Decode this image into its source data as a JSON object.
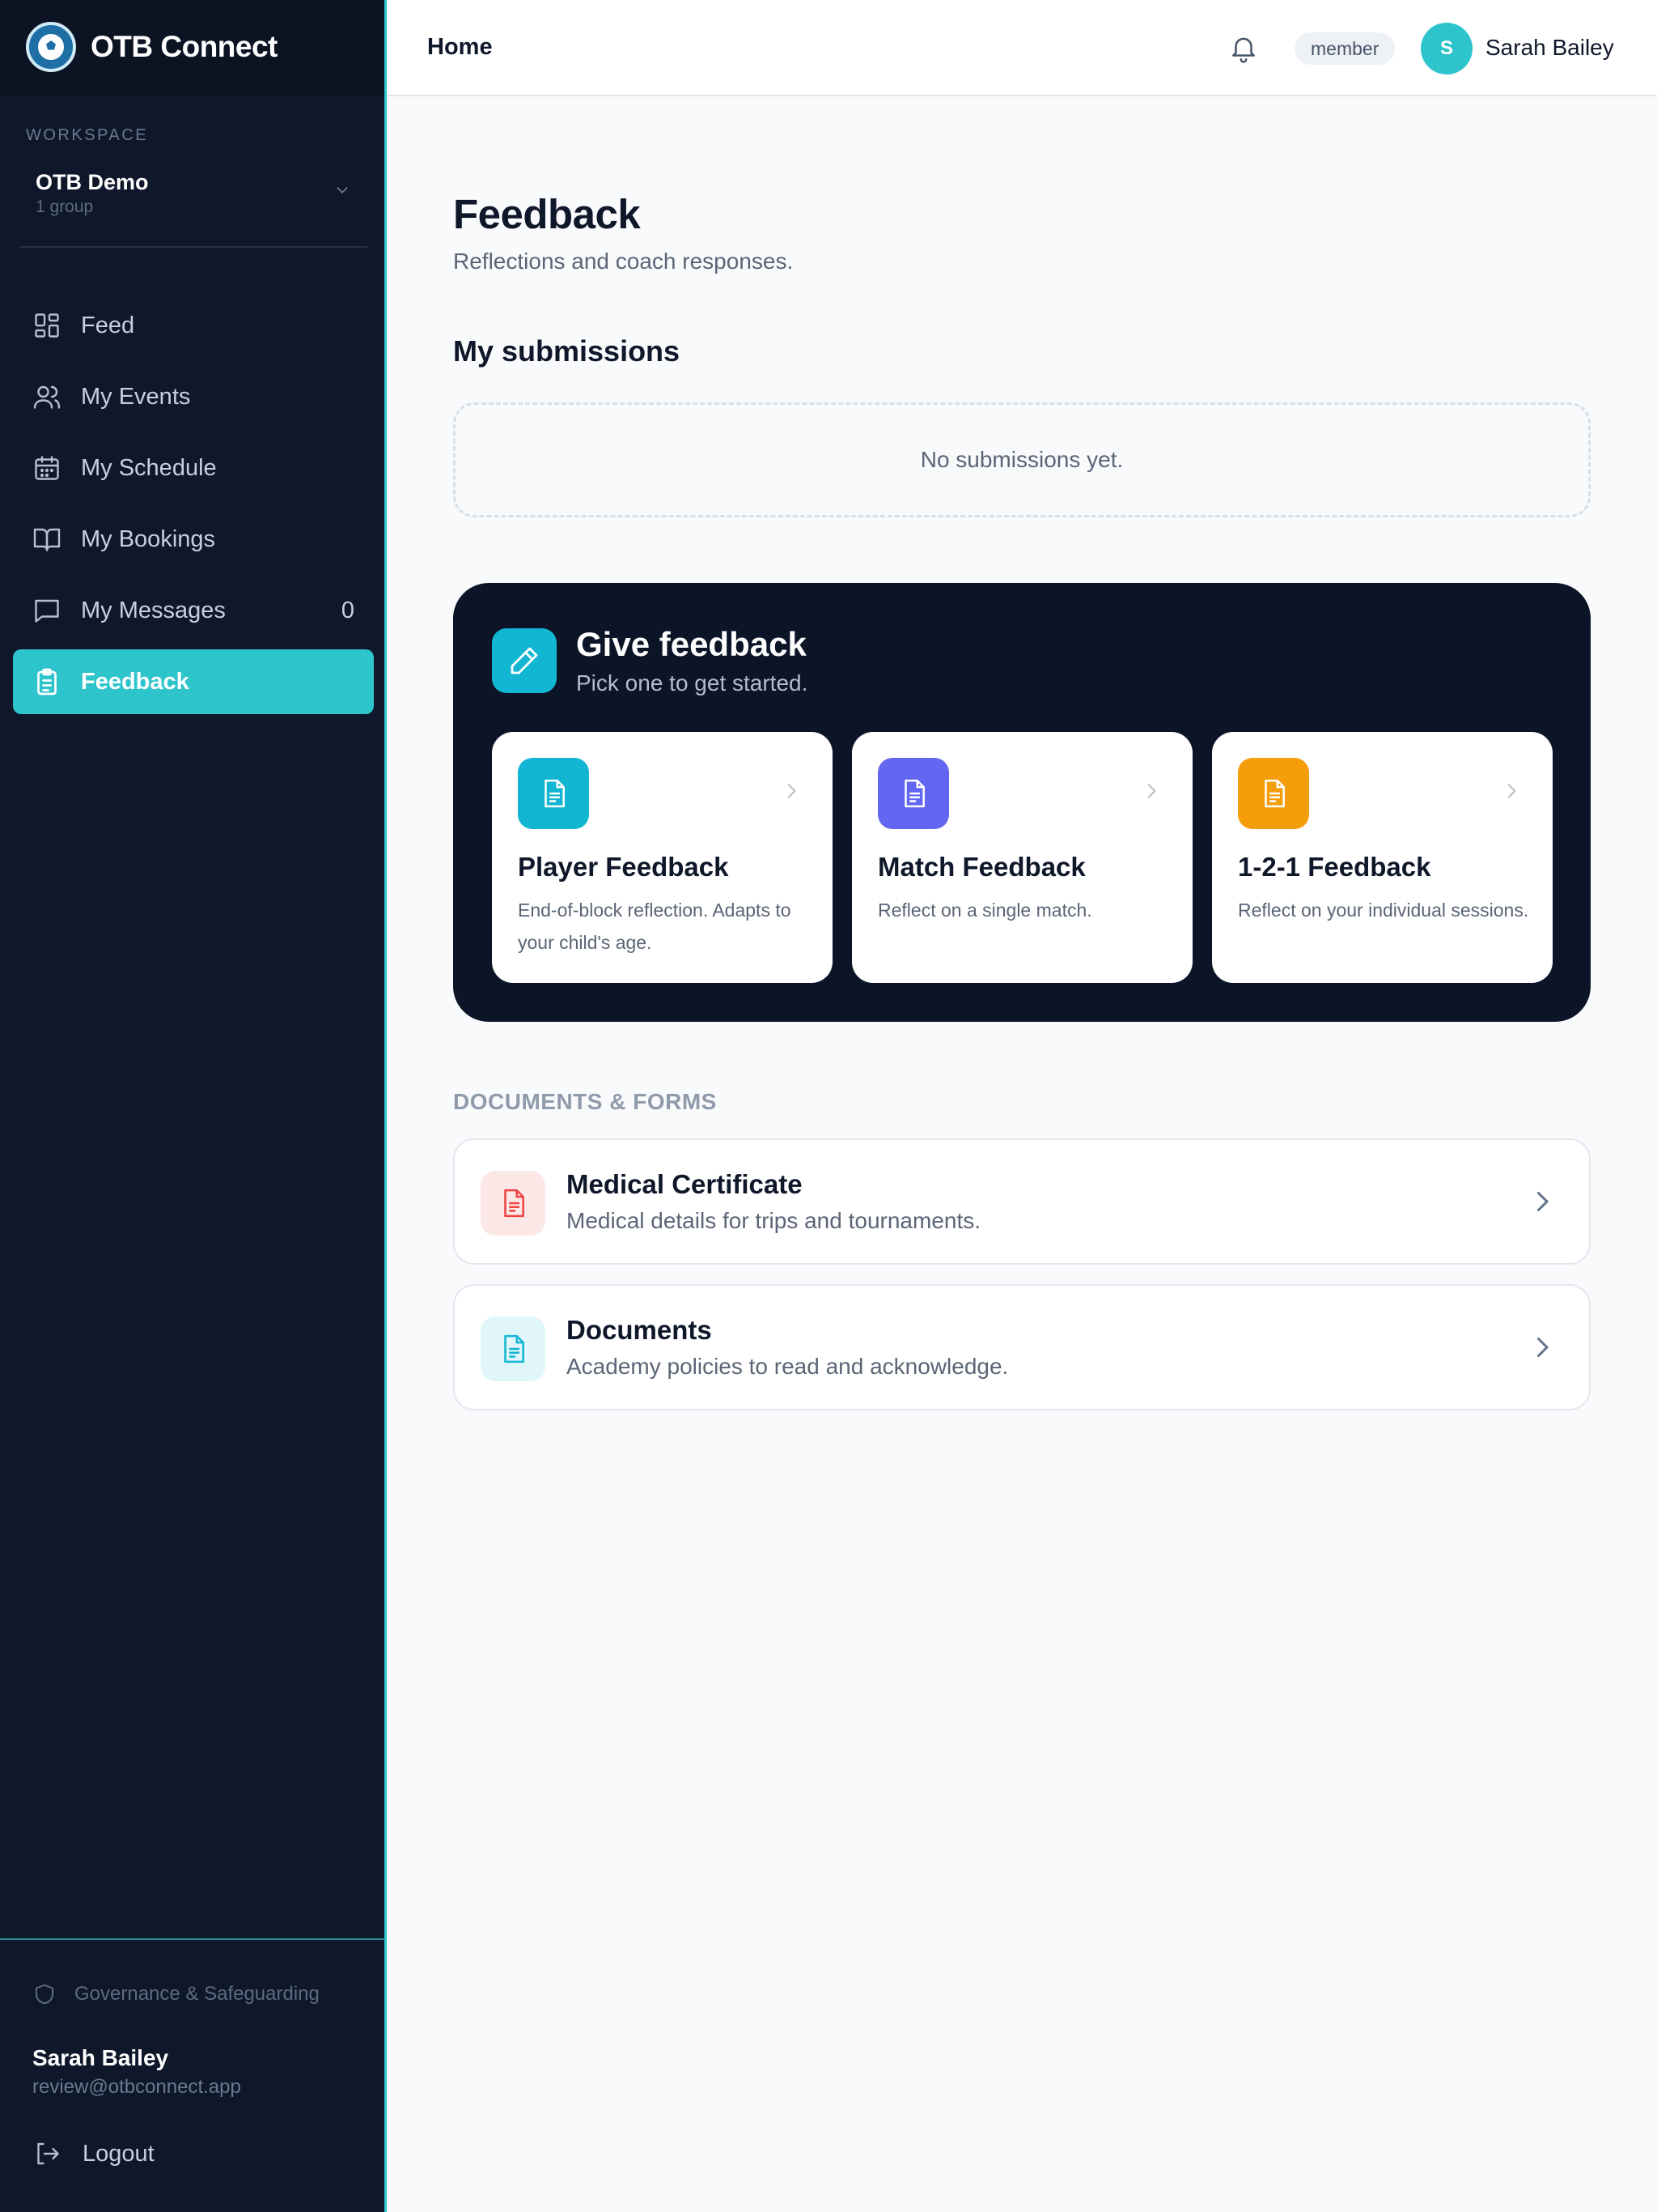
{
  "app": {
    "name": "OTB Connect"
  },
  "workspace": {
    "label": "WORKSPACE",
    "name": "OTB Demo",
    "sub": "1 group"
  },
  "nav": {
    "feed": "Feed",
    "events": "My Events",
    "schedule": "My Schedule",
    "bookings": "My Bookings",
    "messages": "My Messages",
    "messages_count": "0",
    "feedback": "Feedback"
  },
  "sidebar_footer": {
    "governance": "Governance & Safeguarding",
    "user_name": "Sarah Bailey",
    "user_email": "review@otbconnect.app",
    "logout": "Logout"
  },
  "topbar": {
    "breadcrumb": "Home",
    "role": "member",
    "avatar_initial": "S",
    "user_name": "Sarah Bailey"
  },
  "page": {
    "title": "Feedback",
    "subtitle": "Reflections and coach responses."
  },
  "submissions": {
    "title": "My submissions",
    "empty": "No submissions yet."
  },
  "give": {
    "title": "Give feedback",
    "subtitle": "Pick one to get started.",
    "cards": [
      {
        "title": "Player Feedback",
        "desc": "End-of-block reflection. Adapts to your child's age.",
        "color": "#12b6d3"
      },
      {
        "title": "Match Feedback",
        "desc": "Reflect on a single match.",
        "color": "#6366f1"
      },
      {
        "title": "1-2-1 Feedback",
        "desc": "Reflect on your individual sessions.",
        "color": "#f59e0b"
      }
    ]
  },
  "documents": {
    "label": "DOCUMENTS & FORMS",
    "items": [
      {
        "title": "Medical Certificate",
        "desc": "Medical details for trips and tournaments.",
        "icon_color": "#ef4444",
        "icon_bg": "#fde8e8"
      },
      {
        "title": "Documents",
        "desc": "Academy policies to read and acknowledge.",
        "icon_color": "#12b6d3",
        "icon_bg": "#e0f6fa"
      }
    ]
  },
  "colors": {
    "accent": "#2ec4cc",
    "sidebar": "#0f172a",
    "dark_card": "#0b1527"
  }
}
